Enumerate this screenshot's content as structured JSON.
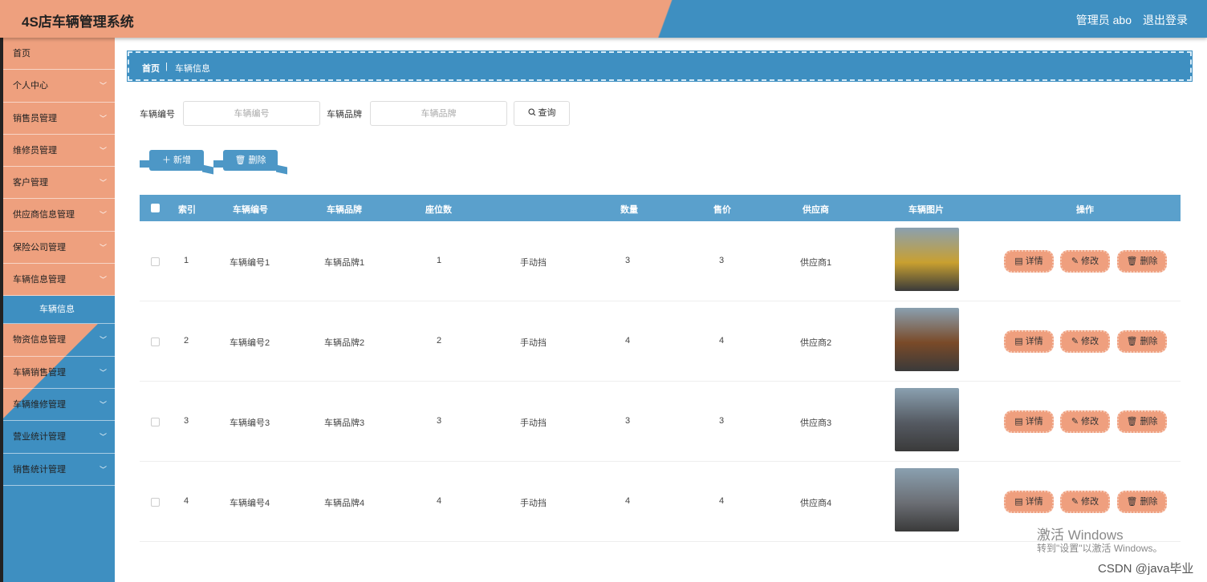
{
  "header": {
    "title": "4S店车辆管理系统",
    "admin": "管理员 abo",
    "logout": "退出登录"
  },
  "sidebar": {
    "items": [
      {
        "label": "首页",
        "chevron": false
      },
      {
        "label": "个人中心",
        "chevron": true
      },
      {
        "label": "销售员管理",
        "chevron": true
      },
      {
        "label": "维修员管理",
        "chevron": true
      },
      {
        "label": "客户管理",
        "chevron": true
      },
      {
        "label": "供应商信息管理",
        "chevron": true
      },
      {
        "label": "保险公司管理",
        "chevron": true
      },
      {
        "label": "车辆信息管理",
        "chevron": true
      }
    ],
    "sub_item": "车辆信息",
    "items_after": [
      {
        "label": "物资信息管理",
        "chevron": true
      },
      {
        "label": "车辆销售管理",
        "chevron": true
      },
      {
        "label": "车辆维修管理",
        "chevron": true
      },
      {
        "label": "营业统计管理",
        "chevron": true
      },
      {
        "label": "销售统计管理",
        "chevron": true
      }
    ]
  },
  "breadcrumb": {
    "home": "首页",
    "separator": "|",
    "current": "车辆信息"
  },
  "search": {
    "field1_label": "车辆编号",
    "field1_placeholder": "车辆编号",
    "field2_label": "车辆品牌",
    "field2_placeholder": "车辆品牌",
    "query_label": "查询"
  },
  "actions": {
    "add_label": "新增",
    "delete_label": "删除"
  },
  "table": {
    "headers": [
      "索引",
      "车辆编号",
      "车辆品牌",
      "座位数",
      "数量",
      "售价",
      "供应商",
      "车辆图片",
      "操作"
    ],
    "rows": [
      {
        "index": "1",
        "code": "车辆编号1",
        "brand": "车辆品牌1",
        "seats": "1",
        "gearbox": "手动挡",
        "qty": "3",
        "price": "3",
        "supplier": "供应商1",
        "img_color": "#c9a030"
      },
      {
        "index": "2",
        "code": "车辆编号2",
        "brand": "车辆品牌2",
        "seats": "2",
        "gearbox": "手动挡",
        "qty": "4",
        "price": "4",
        "supplier": "供应商2",
        "img_color": "#7a4a28"
      },
      {
        "index": "3",
        "code": "车辆编号3",
        "brand": "车辆品牌3",
        "seats": "3",
        "gearbox": "手动挡",
        "qty": "3",
        "price": "3",
        "supplier": "供应商3",
        "img_color": "#555a62"
      },
      {
        "index": "4",
        "code": "车辆编号4",
        "brand": "车辆品牌4",
        "seats": "4",
        "gearbox": "手动挡",
        "qty": "4",
        "price": "4",
        "supplier": "供应商4",
        "img_color": "#6b6e74"
      }
    ],
    "row_actions": {
      "detail": "详情",
      "edit": "修改",
      "delete": "删除"
    }
  },
  "watermark": {
    "line1": "激活 Windows",
    "line2": "转到\"设置\"以激活 Windows。",
    "csdn": "CSDN @java毕业"
  },
  "colors": {
    "accent_orange": "#eea07e",
    "accent_blue": "#3e8fc1"
  }
}
